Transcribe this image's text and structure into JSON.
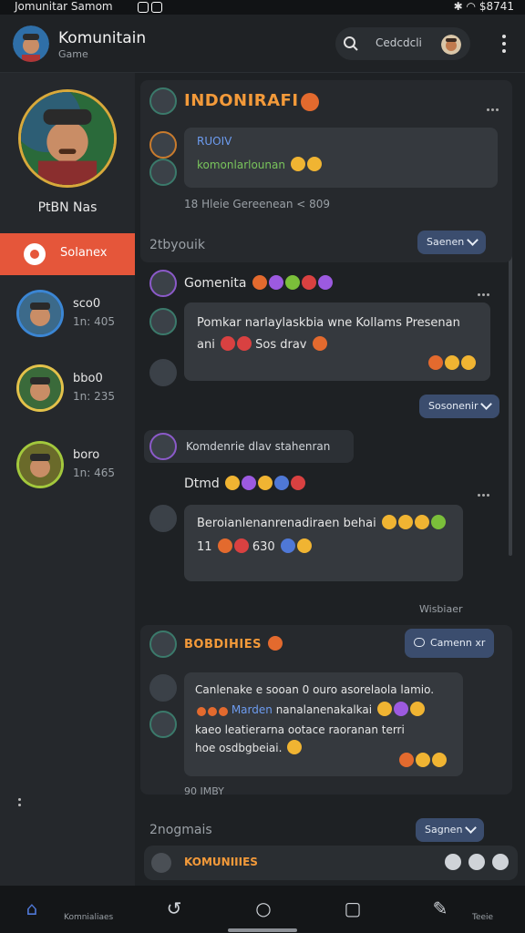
{
  "status_bar": {
    "left_text": "Jomunitar Samom",
    "right_text": "$8741"
  },
  "header": {
    "title": "Komunitain",
    "subtitle": "Game",
    "search_label": "Cedcdcli"
  },
  "sidebar": {
    "profile_name": "PtBN Nas",
    "active_item_label": "Solanex",
    "friends": [
      {
        "name": "sco0",
        "meta": "1n: 405",
        "ring": "#3b86d4"
      },
      {
        "name": "bbo0",
        "meta": "1n: 235",
        "ring": "#e3c24a"
      },
      {
        "name": "boro",
        "meta": "1n: 465",
        "ring": "#a3c83c"
      }
    ]
  },
  "main": {
    "channel_title": "INDONIRAFI",
    "card1": {
      "label1": "RUOIV",
      "label2": "komonlarlounan"
    },
    "timestamp1": "18 Hleie Gereenean < 809",
    "date_divider1": "2tbyouik",
    "btn_primary1": "Saenen",
    "msg1": {
      "author": "Gomenita",
      "text_line1": "Pomkar narlaylaskbia wne Kollams Presenan",
      "text_line2": "ani",
      "text_line3": "Sos drav"
    },
    "btn_primary2": "Sosonenir",
    "notice": "Komdenrie dlav stahenran",
    "msg2": {
      "author": "Dtmd",
      "text_line1": "Beroianlenanrenadiraen behai",
      "text_line2": "11",
      "text_line3": "630"
    },
    "read_status1": "Wisbiaer",
    "section2_title": "BOBDIHIES",
    "section2_button": "Camenn xr",
    "msg3": {
      "line1": "Canlenake e sooan 0 ouro asorelaola lamio.",
      "line2_prefix": "",
      "line2_highlight": "Marden",
      "line2_rest": "nanalanenakalkai",
      "line3": "kaeo leatierarna ootace raoranan terri",
      "line4": "hoe osdbgbeiai."
    },
    "timestamp2": "90 IMBY",
    "date_divider2": "2nogmais",
    "btn_primary3": "Sagnen",
    "input_label": "KOMUNIIIES"
  },
  "navbar": {
    "label_left": "Komnialiaes",
    "label_right": "Teeie"
  },
  "colors": {
    "accent": "#e5563a",
    "primary_button": "#3b4d6e",
    "section_title": "#f39a3a",
    "link_blue": "#6d9cf0"
  }
}
